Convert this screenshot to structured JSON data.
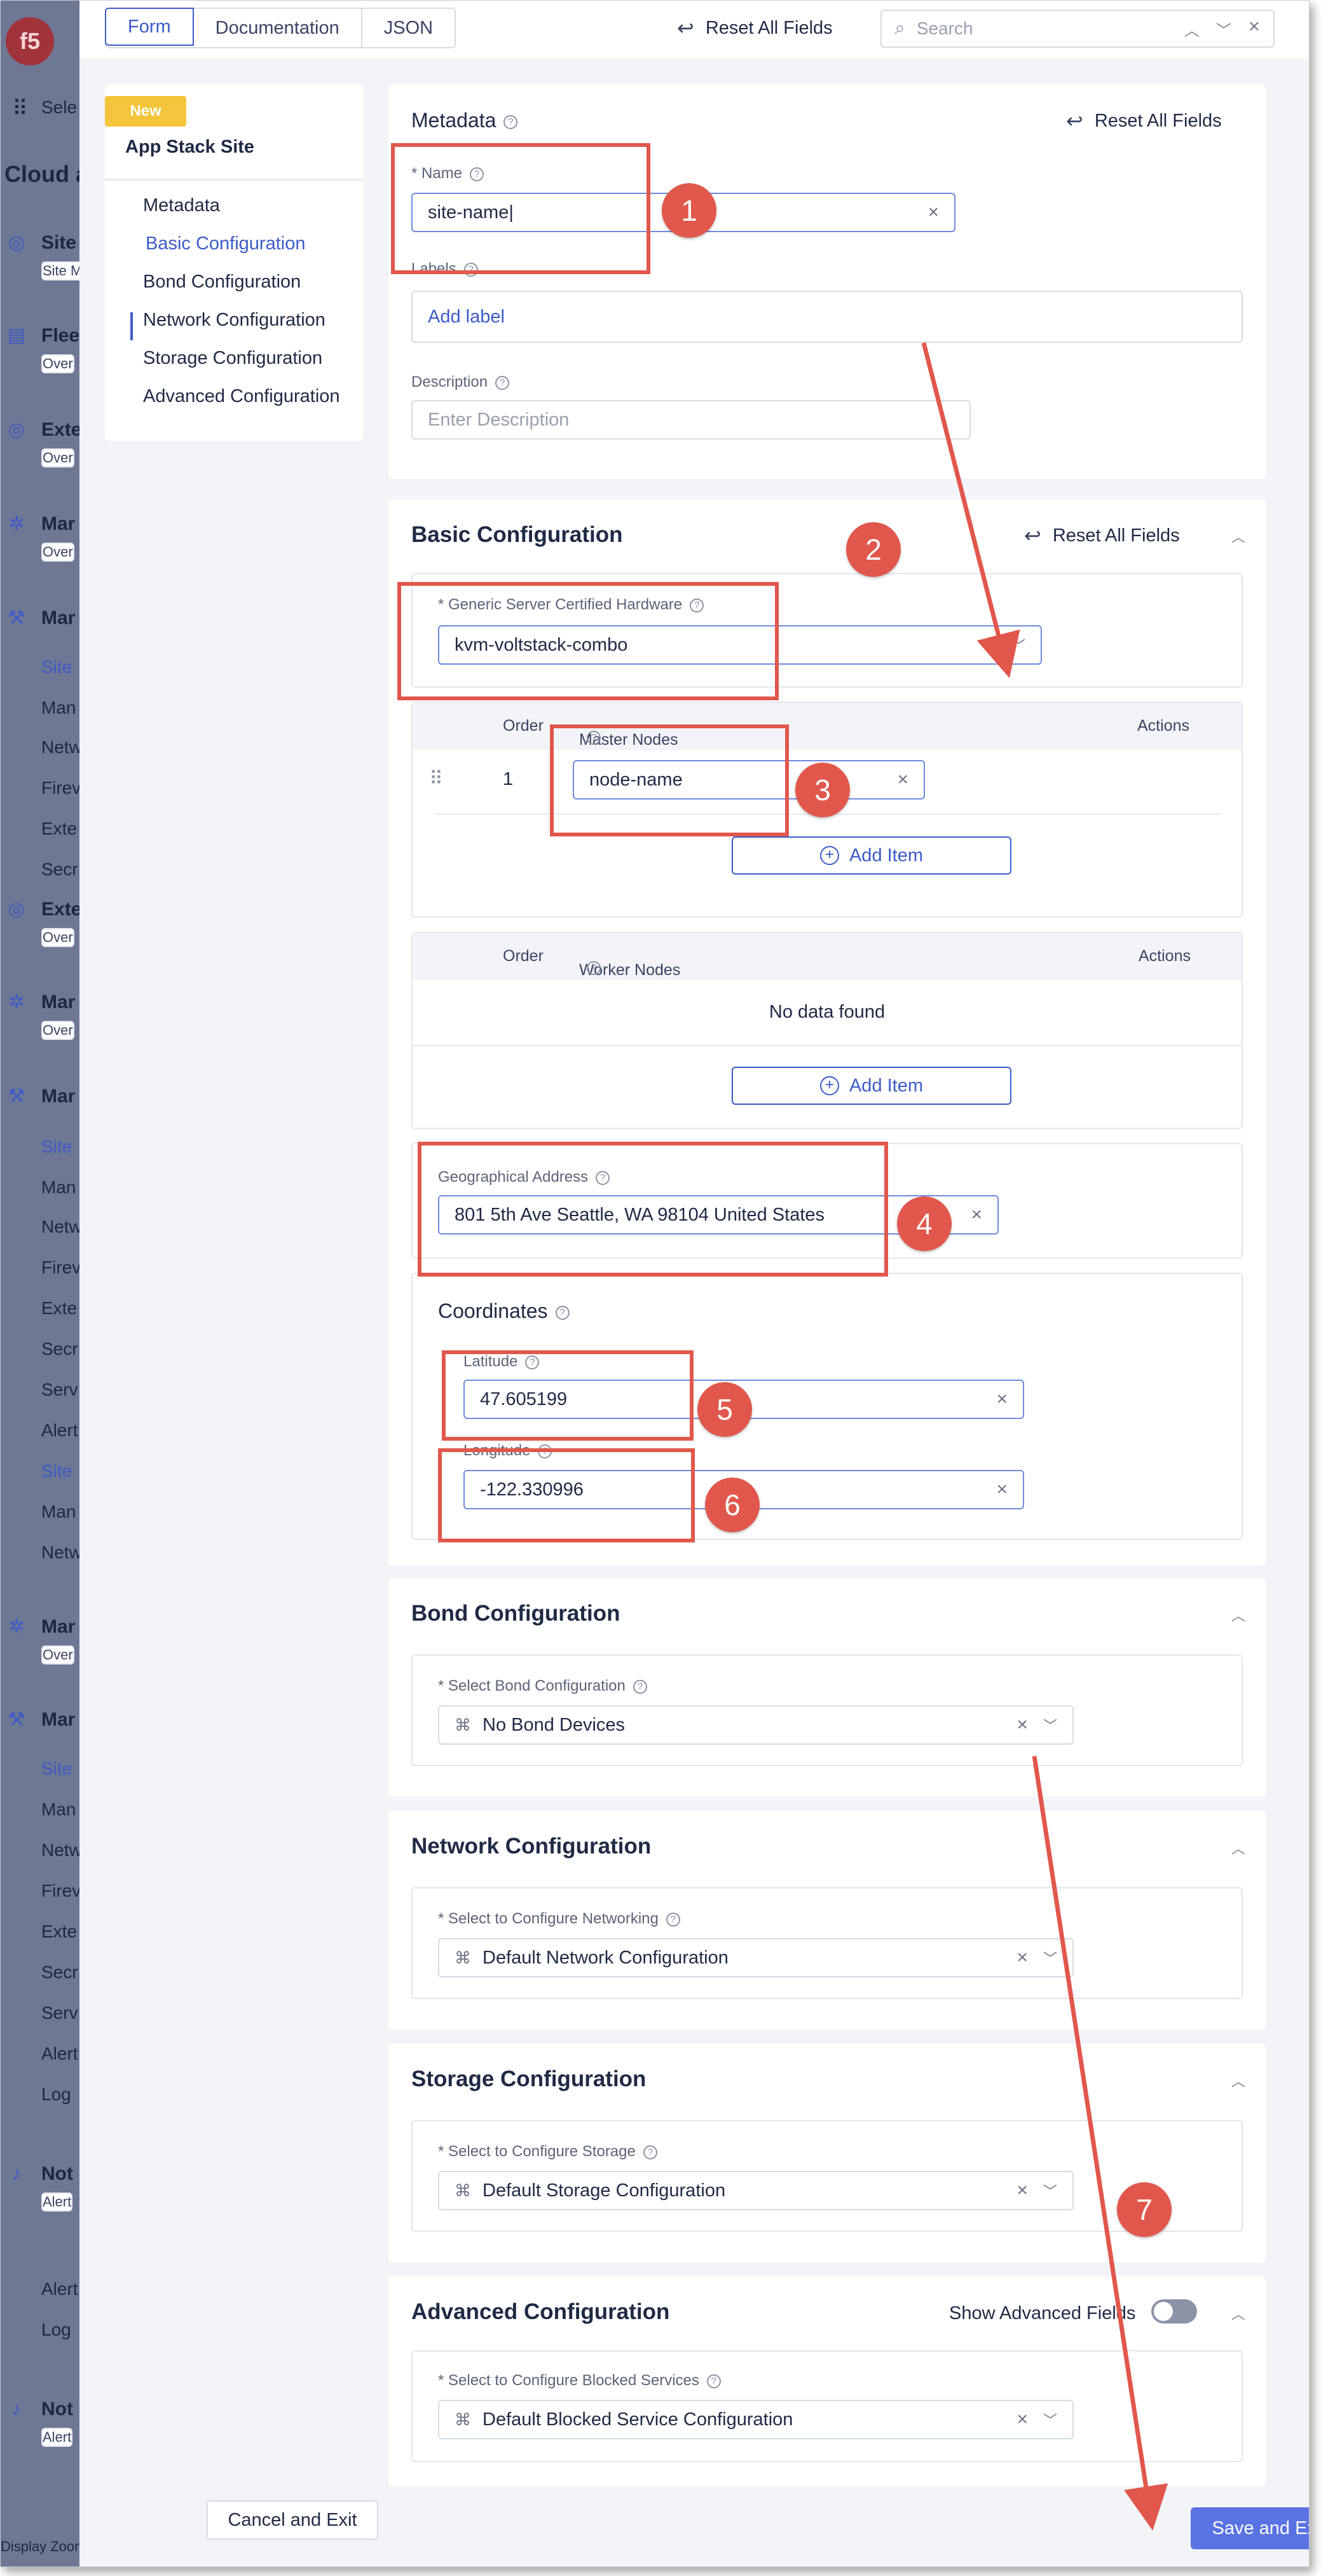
{
  "app_nav": {
    "logo": "f5",
    "apps_label": "Sele",
    "heading": "Cloud a",
    "items": [
      {
        "label": "Site",
        "sub": "Site M"
      },
      {
        "label": "Flee",
        "sub": "Over"
      },
      {
        "label": "Exte",
        "sub": "Over"
      },
      {
        "label": "Mar",
        "sub": "Over"
      },
      {
        "label": "Mar"
      },
      {
        "label": "Site"
      },
      {
        "label": "Man"
      },
      {
        "label": "Netw"
      },
      {
        "label": "Firev"
      },
      {
        "label": "Exte"
      },
      {
        "label": "Secr"
      },
      {
        "label": "Exte",
        "sub": "Over"
      },
      {
        "label": "Mar",
        "sub": "Over"
      },
      {
        "label": "Mar"
      },
      {
        "label": "Site"
      },
      {
        "label": "Man"
      },
      {
        "label": "Netw"
      },
      {
        "label": "Firev"
      },
      {
        "label": "Exte"
      },
      {
        "label": "Secr"
      },
      {
        "label": "Serv"
      },
      {
        "label": "Alert"
      },
      {
        "label": "Site"
      },
      {
        "label": "Man"
      },
      {
        "label": "Netw"
      },
      {
        "label": "Mar",
        "sub": "Over"
      },
      {
        "label": "Mar"
      },
      {
        "label": "Site"
      },
      {
        "label": "Man"
      },
      {
        "label": "Netw"
      },
      {
        "label": "Firev"
      },
      {
        "label": "Exte"
      },
      {
        "label": "Secr"
      },
      {
        "label": "Serv"
      },
      {
        "label": "Alert"
      },
      {
        "label": "Log"
      },
      {
        "label": "Not",
        "sub": "Alert"
      },
      {
        "label": "Alert"
      },
      {
        "label": "Log"
      },
      {
        "label": "Not",
        "sub": "Alert"
      }
    ],
    "footer": "Display Zoom"
  },
  "topbar": {
    "tabs": [
      "Form",
      "Documentation",
      "JSON"
    ],
    "reset_label": "Reset All Fields",
    "search_placeholder": "Search"
  },
  "section_nav": {
    "badge": "New",
    "title": "App Stack Site",
    "items": [
      "Metadata",
      "Basic Configuration",
      "Bond Configuration",
      "Network Configuration",
      "Storage Configuration",
      "Advanced Configuration"
    ],
    "active": "Basic Configuration"
  },
  "metadata": {
    "title": "Metadata",
    "reset_label": "Reset All Fields",
    "name_label": "* Name",
    "name_value": "site-name",
    "labels_label": "Labels",
    "add_label": "Add label",
    "description_label": "Description",
    "description_placeholder": "Enter Description"
  },
  "basic": {
    "title": "Basic Configuration",
    "reset_label": "Reset All Fields",
    "hardware_label": "* Generic Server Certified Hardware",
    "hardware_value": "kvm-voltstack-combo",
    "master": {
      "col_order": "Order",
      "col_name": "Master Nodes",
      "col_actions": "Actions",
      "rows": [
        {
          "order": "1",
          "value": "node-name"
        }
      ],
      "add_item": "Add Item"
    },
    "worker": {
      "col_order": "Order",
      "col_name": "Worker Nodes",
      "col_actions": "Actions",
      "empty": "No data found",
      "add_item": "Add Item"
    },
    "geo_label": "Geographical Address",
    "geo_value": "801 5th Ave Seattle, WA 98104 United States",
    "coords_title": "Coordinates",
    "lat_label": "Latitude",
    "lat_value": "47.605199",
    "lon_label": "Longitude",
    "lon_value": "-122.330996"
  },
  "bond": {
    "title": "Bond Configuration",
    "select_label": "* Select Bond Configuration",
    "select_value": "No Bond Devices"
  },
  "network": {
    "title": "Network Configuration",
    "select_label": "* Select to Configure Networking",
    "select_value": "Default Network Configuration"
  },
  "storage": {
    "title": "Storage Configuration",
    "select_label": "* Select to Configure Storage",
    "select_value": "Default Storage Configuration"
  },
  "advanced": {
    "title": "Advanced Configuration",
    "toggle_label": "Show Advanced Fields",
    "toggle_on": false,
    "select_label": "* Select to Configure Blocked Services",
    "select_value": "Default Blocked Service Configuration"
  },
  "footer": {
    "cancel_label": "Cancel and Exit",
    "save_label": "Save and Exit"
  },
  "annotations": [
    "1",
    "2",
    "3",
    "4",
    "5",
    "6",
    "7"
  ],
  "colors": {
    "accent": "#3d5bc9",
    "annotation": "#e1574c",
    "badge": "#f4c53a",
    "primary_button": "#5a73e3"
  }
}
